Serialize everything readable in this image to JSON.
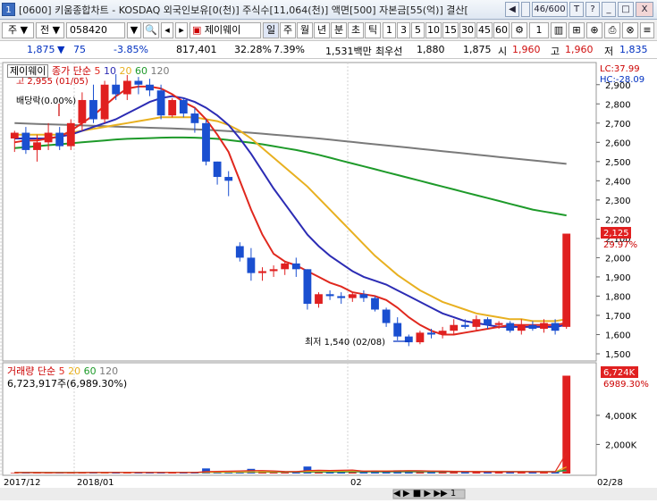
{
  "window": {
    "number": "1",
    "title": "[0600] 키움종합차트 - KOSDAQ 외국인보유[0(천)] 주식수[11,064(천)] 액면[500] 자본금[55(억)] 결산[",
    "page_index": "46/600",
    "buttons": [
      "T",
      "?",
      "_",
      "□",
      "X"
    ]
  },
  "toolbar": {
    "market": "주",
    "code_type": "전",
    "code": "058420",
    "stock_name": "제이웨이",
    "periods": [
      "일",
      "주",
      "월",
      "년",
      "분",
      "초",
      "틱"
    ],
    "intervals": [
      "1",
      "3",
      "5",
      "10",
      "15",
      "30",
      "45",
      "60"
    ],
    "count": "1"
  },
  "quote": {
    "price": "1,875",
    "change_arrow": "▼",
    "change": "75",
    "change_pct": "-3.85%",
    "volume": "817,401",
    "turnover": "32.28%",
    "ratio": "7.39%",
    "amount": "1,531백만",
    "best_ask_label": "최우선",
    "best_ask": "1,880",
    "best_bid": "1,875",
    "open_label": "시",
    "open": "1,960",
    "high_label": "고",
    "high": "1,960",
    "low_label": "저",
    "low": "1,835"
  },
  "price_panel": {
    "stock_label": "제이웨이",
    "ma_label": "종가 단순",
    "ma_periods": [
      {
        "label": "5",
        "color": "#e0281e"
      },
      {
        "label": "10",
        "color": "#2c2cb4"
      },
      {
        "label": "20",
        "color": "#e8b020"
      },
      {
        "label": "60",
        "color": "#1e9a2a"
      },
      {
        "label": "120",
        "color": "#7a7a7a"
      }
    ],
    "high_note": "고 2,955 (01/05)",
    "ex_div_note": "배당락(0.00%)",
    "low_note": "최저 1,540 (02/08)",
    "lc": "LC:37.99",
    "hc": "HC:-28.09",
    "current_price_tag": "2,125",
    "current_pct_tag": "29.97%",
    "y_ticks": [
      "2,900",
      "2,800",
      "2,700",
      "2,600",
      "2,500",
      "2,400",
      "2,300",
      "2,200",
      "2,100",
      "2,000",
      "1,900",
      "1,800",
      "1,700",
      "1,600",
      "1,500"
    ]
  },
  "volume_panel": {
    "label": "거래량 단순",
    "ma_periods": [
      {
        "label": "5",
        "color": "#e0281e"
      },
      {
        "label": "20",
        "color": "#e8b020"
      },
      {
        "label": "60",
        "color": "#1e9a2a"
      },
      {
        "label": "120",
        "color": "#7a7a7a"
      }
    ],
    "value_note": "6,723,917주(6,989.30%)",
    "tag_value": "6,724K",
    "tag_pct": "6989.30%",
    "y_ticks": [
      "4,000K",
      "2,000K"
    ]
  },
  "x_axis": {
    "labels": [
      "2017/12",
      "2018/01",
      "02",
      "02/28"
    ]
  },
  "bottom_controls": [
    "◀",
    "▶",
    "■",
    "▶",
    "▶▶",
    "1"
  ],
  "chart_data": [
    {
      "type": "candlestick",
      "title": "제이웨이",
      "ylim": [
        1500,
        2950
      ],
      "x_labels": [
        "2017/12",
        "2018/01",
        "02",
        "02/28"
      ],
      "candles": [
        {
          "o": 2620,
          "h": 2660,
          "l": 2550,
          "c": 2650
        },
        {
          "o": 2650,
          "h": 2680,
          "l": 2540,
          "c": 2560
        },
        {
          "o": 2560,
          "h": 2640,
          "l": 2500,
          "c": 2600
        },
        {
          "o": 2600,
          "h": 2700,
          "l": 2560,
          "c": 2650
        },
        {
          "o": 2650,
          "h": 2680,
          "l": 2560,
          "c": 2580
        },
        {
          "o": 2580,
          "h": 2720,
          "l": 2560,
          "c": 2700
        },
        {
          "o": 2700,
          "h": 2860,
          "l": 2660,
          "c": 2820
        },
        {
          "o": 2820,
          "h": 2900,
          "l": 2700,
          "c": 2720
        },
        {
          "o": 2720,
          "h": 2920,
          "l": 2700,
          "c": 2900
        },
        {
          "o": 2900,
          "h": 2955,
          "l": 2820,
          "c": 2850
        },
        {
          "o": 2850,
          "h": 2950,
          "l": 2820,
          "c": 2920
        },
        {
          "o": 2920,
          "h": 2940,
          "l": 2850,
          "c": 2900
        },
        {
          "o": 2900,
          "h": 2930,
          "l": 2840,
          "c": 2870
        },
        {
          "o": 2870,
          "h": 2900,
          "l": 2720,
          "c": 2740
        },
        {
          "o": 2740,
          "h": 2830,
          "l": 2730,
          "c": 2820
        },
        {
          "o": 2820,
          "h": 2830,
          "l": 2730,
          "c": 2750
        },
        {
          "o": 2750,
          "h": 2780,
          "l": 2650,
          "c": 2700
        },
        {
          "o": 2700,
          "h": 2720,
          "l": 2480,
          "c": 2500
        },
        {
          "o": 2500,
          "h": 2500,
          "l": 2380,
          "c": 2420
        },
        {
          "o": 2420,
          "h": 2450,
          "l": 2320,
          "c": 2400
        },
        {
          "o": 2060,
          "h": 2080,
          "l": 1980,
          "c": 2000
        },
        {
          "o": 2000,
          "h": 2050,
          "l": 1880,
          "c": 1920
        },
        {
          "o": 1920,
          "h": 1950,
          "l": 1880,
          "c": 1930
        },
        {
          "o": 1930,
          "h": 1960,
          "l": 1900,
          "c": 1940
        },
        {
          "o": 1940,
          "h": 1980,
          "l": 1910,
          "c": 1970
        },
        {
          "o": 1970,
          "h": 2000,
          "l": 1900,
          "c": 1940
        },
        {
          "o": 1940,
          "h": 1940,
          "l": 1730,
          "c": 1760
        },
        {
          "o": 1760,
          "h": 1820,
          "l": 1740,
          "c": 1810
        },
        {
          "o": 1810,
          "h": 1830,
          "l": 1780,
          "c": 1800
        },
        {
          "o": 1800,
          "h": 1820,
          "l": 1760,
          "c": 1790
        },
        {
          "o": 1790,
          "h": 1820,
          "l": 1770,
          "c": 1810
        },
        {
          "o": 1810,
          "h": 1830,
          "l": 1770,
          "c": 1790
        },
        {
          "o": 1790,
          "h": 1800,
          "l": 1720,
          "c": 1730
        },
        {
          "o": 1730,
          "h": 1740,
          "l": 1640,
          "c": 1660
        },
        {
          "o": 1660,
          "h": 1690,
          "l": 1570,
          "c": 1590
        },
        {
          "o": 1590,
          "h": 1600,
          "l": 1540,
          "c": 1560
        },
        {
          "o": 1560,
          "h": 1620,
          "l": 1550,
          "c": 1610
        },
        {
          "o": 1610,
          "h": 1630,
          "l": 1580,
          "c": 1600
        },
        {
          "o": 1600,
          "h": 1640,
          "l": 1580,
          "c": 1620
        },
        {
          "o": 1620,
          "h": 1680,
          "l": 1600,
          "c": 1650
        },
        {
          "o": 1650,
          "h": 1680,
          "l": 1630,
          "c": 1640
        },
        {
          "o": 1640,
          "h": 1700,
          "l": 1620,
          "c": 1680
        },
        {
          "o": 1680,
          "h": 1690,
          "l": 1630,
          "c": 1650
        },
        {
          "o": 1650,
          "h": 1670,
          "l": 1630,
          "c": 1660
        },
        {
          "o": 1660,
          "h": 1670,
          "l": 1610,
          "c": 1620
        },
        {
          "o": 1620,
          "h": 1680,
          "l": 1600,
          "c": 1650
        },
        {
          "o": 1650,
          "h": 1670,
          "l": 1620,
          "c": 1630
        },
        {
          "o": 1630,
          "h": 1680,
          "l": 1610,
          "c": 1660
        },
        {
          "o": 1660,
          "h": 1680,
          "l": 1600,
          "c": 1620
        },
        {
          "o": 1640,
          "h": 2125,
          "l": 1630,
          "c": 2125
        }
      ],
      "ma": [
        {
          "label": "5",
          "color": "#e0281e",
          "values": [
            2600,
            2610,
            2610,
            2620,
            2630,
            2660,
            2700,
            2740,
            2790,
            2840,
            2880,
            2890,
            2890,
            2880,
            2850,
            2810,
            2780,
            2720,
            2640,
            2550,
            2400,
            2250,
            2120,
            2020,
            1980,
            1960,
            1930,
            1900,
            1870,
            1850,
            1820,
            1810,
            1800,
            1780,
            1740,
            1690,
            1650,
            1620,
            1600,
            1600,
            1610,
            1620,
            1630,
            1640,
            1650,
            1650,
            1650,
            1650,
            1650,
            1660
          ]
        },
        {
          "label": "10",
          "color": "#2c2cb4",
          "values": [
            2620,
            2620,
            2620,
            2620,
            2630,
            2640,
            2660,
            2680,
            2700,
            2720,
            2750,
            2780,
            2810,
            2830,
            2840,
            2830,
            2810,
            2780,
            2740,
            2690,
            2620,
            2540,
            2450,
            2360,
            2280,
            2200,
            2120,
            2060,
            2010,
            1970,
            1930,
            1900,
            1880,
            1860,
            1830,
            1800,
            1770,
            1740,
            1710,
            1690,
            1670,
            1660,
            1650,
            1640,
            1640,
            1640,
            1640,
            1640,
            1640,
            1650
          ]
        },
        {
          "label": "20",
          "color": "#e8b020",
          "values": [
            2640,
            2640,
            2640,
            2640,
            2640,
            2650,
            2660,
            2670,
            2680,
            2690,
            2700,
            2710,
            2720,
            2730,
            2730,
            2730,
            2730,
            2720,
            2710,
            2690,
            2660,
            2620,
            2570,
            2520,
            2470,
            2420,
            2370,
            2310,
            2250,
            2190,
            2130,
            2070,
            2010,
            1960,
            1910,
            1870,
            1830,
            1800,
            1770,
            1750,
            1730,
            1710,
            1700,
            1690,
            1680,
            1680,
            1670,
            1670,
            1670,
            1680
          ]
        },
        {
          "label": "60",
          "color": "#1e9a2a",
          "values": [
            2570,
            2575,
            2580,
            2585,
            2590,
            2595,
            2600,
            2605,
            2610,
            2615,
            2618,
            2620,
            2622,
            2624,
            2625,
            2625,
            2624,
            2622,
            2618,
            2612,
            2605,
            2598,
            2590,
            2580,
            2570,
            2560,
            2548,
            2535,
            2520,
            2505,
            2490,
            2475,
            2460,
            2445,
            2430,
            2415,
            2400,
            2385,
            2370,
            2355,
            2340,
            2325,
            2310,
            2295,
            2280,
            2265,
            2250,
            2240,
            2230,
            2220
          ]
        },
        {
          "label": "120",
          "color": "#7a7a7a",
          "values": [
            2700,
            2698,
            2696,
            2694,
            2692,
            2690,
            2688,
            2686,
            2684,
            2682,
            2680,
            2678,
            2676,
            2674,
            2672,
            2670,
            2668,
            2665,
            2662,
            2658,
            2654,
            2650,
            2645,
            2640,
            2635,
            2630,
            2625,
            2620,
            2614,
            2608,
            2602,
            2596,
            2590,
            2584,
            2578,
            2572,
            2566,
            2560,
            2554,
            2548,
            2542,
            2536,
            2530,
            2524,
            2518,
            2512,
            2506,
            2500,
            2494,
            2488
          ]
        }
      ]
    },
    {
      "type": "bar",
      "title": "거래량",
      "ylim": [
        0,
        7000
      ],
      "ylabel": "K",
      "values": [
        40,
        60,
        50,
        40,
        70,
        60,
        90,
        80,
        70,
        60,
        90,
        70,
        60,
        80,
        60,
        70,
        70,
        350,
        120,
        150,
        110,
        320,
        180,
        110,
        100,
        120,
        480,
        200,
        150,
        120,
        140,
        180,
        210,
        160,
        220,
        190,
        150,
        130,
        170,
        110,
        140,
        120,
        100,
        130,
        120,
        140,
        110,
        130,
        120,
        6724
      ],
      "ma": [
        {
          "label": "5",
          "color": "#e0281e",
          "values": [
            60,
            60,
            60,
            55,
            55,
            55,
            60,
            70,
            75,
            70,
            75,
            70,
            65,
            65,
            65,
            70,
            70,
            130,
            150,
            160,
            180,
            200,
            200,
            180,
            140,
            130,
            200,
            220,
            210,
            220,
            240,
            160,
            170,
            160,
            180,
            190,
            190,
            170,
            160,
            150,
            140,
            130,
            120,
            120,
            120,
            120,
            120,
            120,
            120,
            1400
          ]
        },
        {
          "label": "20",
          "color": "#e8b020",
          "values": [
            60,
            60,
            60,
            60,
            60,
            60,
            60,
            62,
            64,
            65,
            66,
            67,
            68,
            69,
            70,
            71,
            72,
            85,
            92,
            100,
            104,
            118,
            124,
            128,
            130,
            132,
            150,
            158,
            162,
            166,
            170,
            172,
            176,
            180,
            185,
            188,
            180,
            168,
            160,
            152,
            146,
            140,
            132,
            128,
            125,
            122,
            120,
            118,
            118,
            450
          ]
        },
        {
          "label": "60",
          "color": "#1e9a2a",
          "values": [
            70,
            70,
            70,
            70,
            70,
            70,
            70,
            70,
            70,
            70,
            70,
            70,
            70,
            70,
            72,
            74,
            76,
            80,
            84,
            88,
            92,
            96,
            100,
            104,
            108,
            112,
            116,
            120,
            122,
            124,
            126,
            128,
            130,
            132,
            134,
            136,
            136,
            136,
            136,
            136,
            135,
            134,
            133,
            132,
            131,
            130,
            129,
            128,
            127,
            240
          ]
        },
        {
          "label": "120",
          "color": "#7a7a7a",
          "values": [
            75,
            75,
            75,
            75,
            75,
            75,
            75,
            75,
            75,
            75,
            75,
            75,
            75,
            76,
            77,
            78,
            79,
            80,
            82,
            84,
            86,
            88,
            90,
            92,
            94,
            96,
            98,
            100,
            102,
            104,
            106,
            108,
            110,
            112,
            114,
            116,
            117,
            118,
            119,
            120,
            120,
            120,
            120,
            120,
            120,
            120,
            120,
            120,
            120,
            175
          ]
        }
      ]
    }
  ]
}
